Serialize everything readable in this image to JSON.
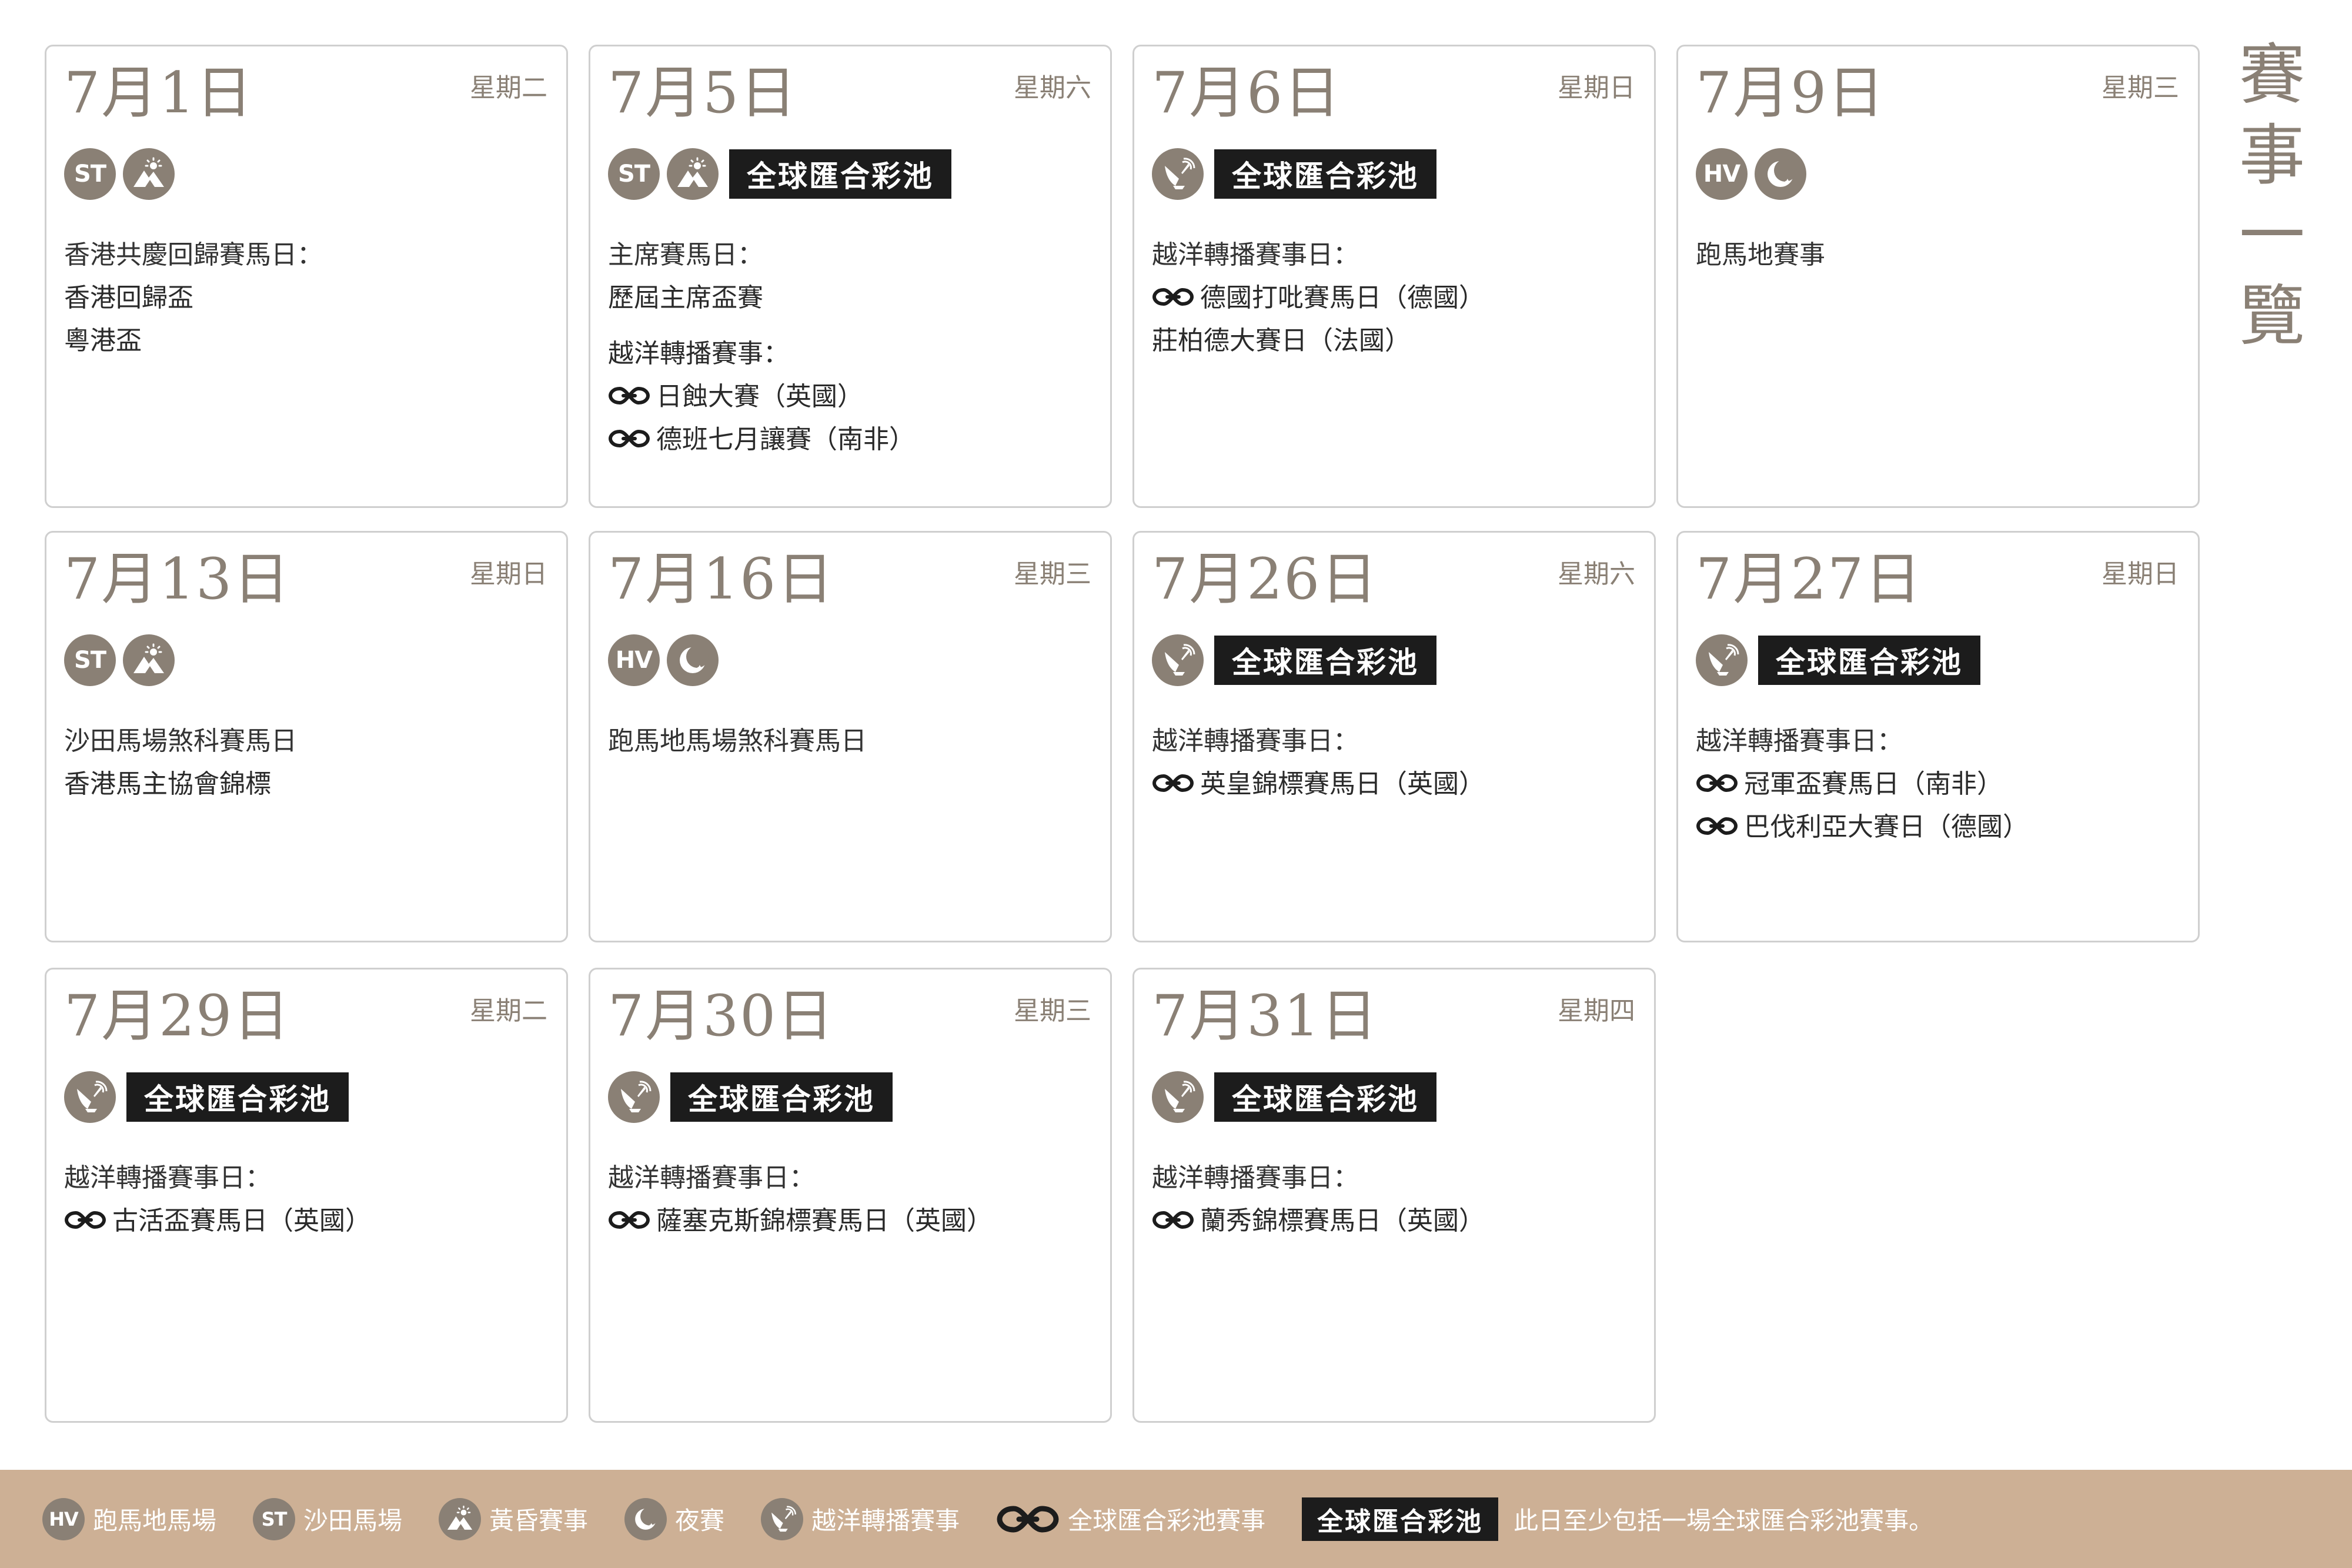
{
  "page": {
    "title": "賽事一覽"
  },
  "colors": {
    "accent": "#8a8075",
    "badge_bg": "#1c1c1c",
    "footer_bg": "#cdb095",
    "border": "#cfcfcf"
  },
  "days": [
    {
      "date": "7月1日",
      "weekday": "星期二",
      "icons": [
        "ST",
        "twilight-icon"
      ],
      "badge": "",
      "lines": [
        {
          "text": "香港共慶回歸賽馬日："
        },
        {
          "text": "香港回歸盃"
        },
        {
          "text": "粵港盃"
        }
      ]
    },
    {
      "date": "7月5日",
      "weekday": "星期六",
      "icons": [
        "ST",
        "twilight-icon"
      ],
      "badge": "全球匯合彩池",
      "lines": [
        {
          "text": "主席賽馬日："
        },
        {
          "text": "歷屆主席盃賽"
        },
        {
          "text": "越洋轉播賽事：",
          "gap": true
        },
        {
          "text": "日蝕大賽（英國）",
          "link": true
        },
        {
          "text": "德班七月讓賽（南非）",
          "link": true
        }
      ]
    },
    {
      "date": "7月6日",
      "weekday": "星期日",
      "icons": [
        "simulcast-icon"
      ],
      "badge": "全球匯合彩池",
      "lines": [
        {
          "text": "越洋轉播賽事日："
        },
        {
          "text": "德國打吡賽馬日（德國）",
          "link": true
        },
        {
          "text": "莊柏德大賽日（法國）"
        }
      ]
    },
    {
      "date": "7月9日",
      "weekday": "星期三",
      "icons": [
        "HV",
        "night-icon"
      ],
      "badge": "",
      "lines": [
        {
          "text": "跑馬地賽事"
        }
      ]
    },
    {
      "date": "7月13日",
      "weekday": "星期日",
      "icons": [
        "ST",
        "twilight-icon"
      ],
      "badge": "",
      "lines": [
        {
          "text": "沙田馬場煞科賽馬日"
        },
        {
          "text": "香港馬主協會錦標"
        }
      ]
    },
    {
      "date": "7月16日",
      "weekday": "星期三",
      "icons": [
        "HV",
        "night-icon"
      ],
      "badge": "",
      "lines": [
        {
          "text": "跑馬地馬場煞科賽馬日"
        }
      ]
    },
    {
      "date": "7月26日",
      "weekday": "星期六",
      "icons": [
        "simulcast-icon"
      ],
      "badge": "全球匯合彩池",
      "lines": [
        {
          "text": "越洋轉播賽事日："
        },
        {
          "text": "英皇錦標賽馬日（英國）",
          "link": true
        }
      ]
    },
    {
      "date": "7月27日",
      "weekday": "星期日",
      "icons": [
        "simulcast-icon"
      ],
      "badge": "全球匯合彩池",
      "lines": [
        {
          "text": "越洋轉播賽事日："
        },
        {
          "text": "冠軍盃賽馬日（南非）",
          "link": true
        },
        {
          "text": "巴伐利亞大賽日（德國）",
          "link": true
        }
      ]
    },
    {
      "date": "7月29日",
      "weekday": "星期二",
      "icons": [
        "simulcast-icon"
      ],
      "badge": "全球匯合彩池",
      "lines": [
        {
          "text": "越洋轉播賽事日："
        },
        {
          "text": "古活盃賽馬日（英國）",
          "link": true
        }
      ]
    },
    {
      "date": "7月30日",
      "weekday": "星期三",
      "icons": [
        "simulcast-icon"
      ],
      "badge": "全球匯合彩池",
      "lines": [
        {
          "text": "越洋轉播賽事日："
        },
        {
          "text": "薩塞克斯錦標賽馬日（英國）",
          "link": true
        }
      ]
    },
    {
      "date": "7月31日",
      "weekday": "星期四",
      "icons": [
        "simulcast-icon"
      ],
      "badge": "全球匯合彩池",
      "lines": [
        {
          "text": "越洋轉播賽事日："
        },
        {
          "text": "蘭秀錦標賽馬日（英國）",
          "link": true
        }
      ]
    }
  ],
  "legend": {
    "hv": {
      "icon_text": "HV",
      "label": "跑馬地馬場"
    },
    "st": {
      "icon_text": "ST",
      "label": "沙田馬場"
    },
    "twilight": {
      "icon": "twilight-icon",
      "label": "黃昏賽事"
    },
    "night": {
      "icon": "night-icon",
      "label": "夜賽"
    },
    "simulcast": {
      "icon": "simulcast-icon",
      "label": "越洋轉播賽事"
    },
    "pool": {
      "icon": "link-icon",
      "label": "全球匯合彩池賽事"
    },
    "badge": {
      "label": "全球匯合彩池",
      "note": "此日至少包括一場全球匯合彩池賽事。"
    }
  }
}
